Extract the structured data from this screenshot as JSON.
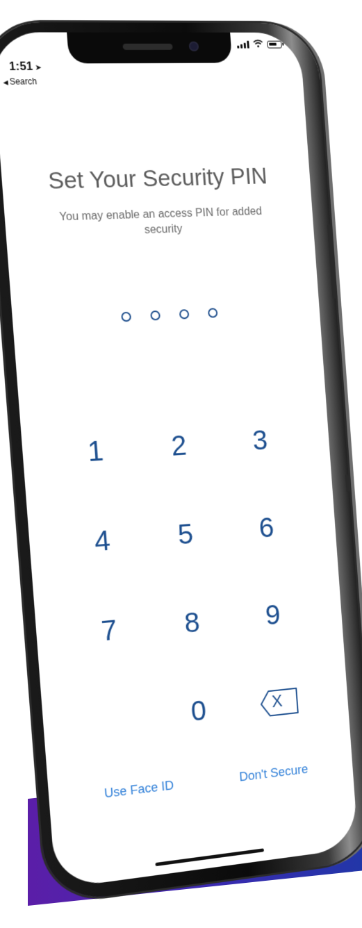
{
  "status_bar": {
    "time": "1:51",
    "location_glyph": "➤",
    "back_label": "Search",
    "icons": [
      "signal-icon",
      "wifi-icon",
      "battery-icon"
    ]
  },
  "content": {
    "title": "Set Your Security PIN",
    "subtitle": "You may enable an access PIN for added security",
    "pin_length": 4
  },
  "keypad": {
    "keys": [
      "1",
      "2",
      "3",
      "4",
      "5",
      "6",
      "7",
      "8",
      "9",
      "",
      "0",
      "backspace"
    ],
    "backspace_symbol": "X"
  },
  "actions": {
    "face_id_label": "Use Face ID",
    "dont_secure_label": "Don't Secure"
  },
  "colors": {
    "accent": "#1d4f8f",
    "link": "#2f7fd8",
    "title": "#5c5c5c",
    "background_band": "#3a2ab0"
  }
}
